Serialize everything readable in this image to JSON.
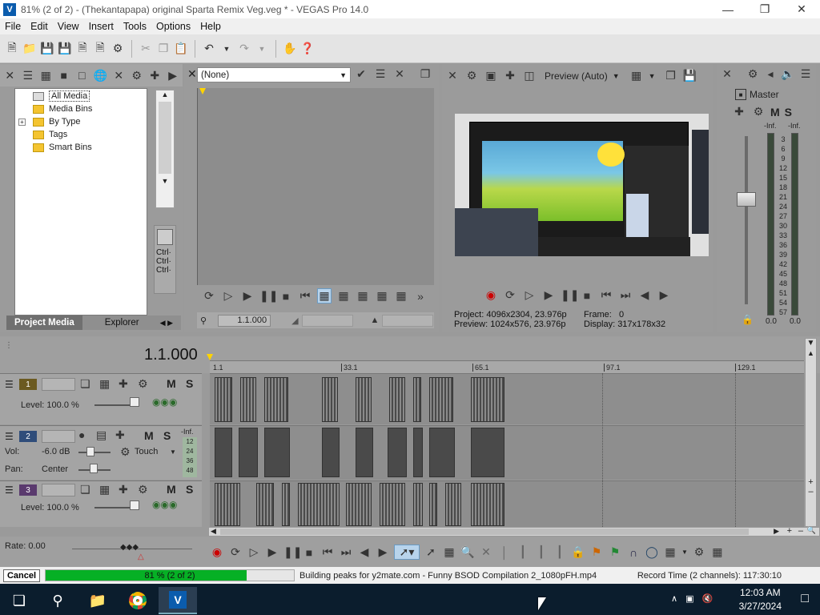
{
  "window": {
    "title": "81% (2 of 2) - (Thekantapapa) original Sparta Remix Veg.veg * - VEGAS Pro 14.0",
    "minimize_icon": "minimize-icon",
    "maximize_icon": "restore-icon",
    "close_icon": "close-icon"
  },
  "menu": [
    "File",
    "Edit",
    "View",
    "Insert",
    "Tools",
    "Options",
    "Help"
  ],
  "explorer": {
    "tree": [
      {
        "label": "All Media",
        "selected": true
      },
      {
        "label": "Media Bins"
      },
      {
        "label": "By Type",
        "expandable": true
      },
      {
        "label": "Tags"
      },
      {
        "label": "Smart Bins"
      }
    ],
    "ctrl_labels": [
      "Ctrl·",
      "Ctrl·",
      "Ctrl·"
    ],
    "tabs": [
      "Project Media",
      "Explorer"
    ]
  },
  "trimmer": {
    "selection": "(None)",
    "time": "1.1.000"
  },
  "preview": {
    "mode_label": "Preview (Auto)",
    "project_label": "Project:",
    "project_value": "4096x2304, 23.976p",
    "preview_label": "Preview:",
    "preview_value": "1024x576, 23.976p",
    "frame_label": "Frame:",
    "frame_value": "0",
    "display_label": "Display:",
    "display_value": "317x178x32"
  },
  "master": {
    "label": "Master",
    "m_label": "M",
    "s_label": "S",
    "inf_left": "-Inf.",
    "inf_right": "-Inf.",
    "scale": [
      "3",
      "6",
      "9",
      "12",
      "15",
      "18",
      "21",
      "24",
      "27",
      "30",
      "33",
      "36",
      "39",
      "42",
      "45",
      "48",
      "51",
      "54",
      "57"
    ],
    "left_value": "0.0",
    "right_value": "0.0"
  },
  "timeline": {
    "cursor_time": "1.1.000",
    "ruler": [
      "1.1",
      "33.1",
      "65.1",
      "97.1",
      "129.1"
    ],
    "tracks": [
      {
        "number": "1",
        "type": "video",
        "level_label": "Level: 100.0 %",
        "m": "M",
        "s": "S"
      },
      {
        "number": "2",
        "type": "audio",
        "vol_label": "Vol:",
        "vol_value": "-6.0 dB",
        "pan_label": "Pan:",
        "pan_value": "Center",
        "automation": "Touch",
        "m": "M",
        "s": "S",
        "inf": "-Inf.",
        "meter_ticks": [
          "12",
          "24",
          "36",
          "48"
        ]
      },
      {
        "number": "3",
        "type": "video",
        "level_label": "Level: 100.0 %",
        "m": "M",
        "s": "S"
      }
    ],
    "rate_label": "Rate: 0.00"
  },
  "status": {
    "cancel": "Cancel",
    "progress_text": "81 % (2 of 2)",
    "progress_fraction": 0.81,
    "message": "Building peaks for y2mate.com - Funny BSOD Compilation 2_1080pFH.mp4",
    "record_time": "Record Time (2 channels): 117:30:10"
  },
  "taskbar": {
    "time": "12:03 AM",
    "date": "3/27/2024"
  },
  "colors": {
    "track1": "#6b5a20",
    "track2": "#2f4d7a",
    "track3": "#5a3a6e",
    "progress": "#06b025",
    "taskbar": "#0b1d2d"
  }
}
